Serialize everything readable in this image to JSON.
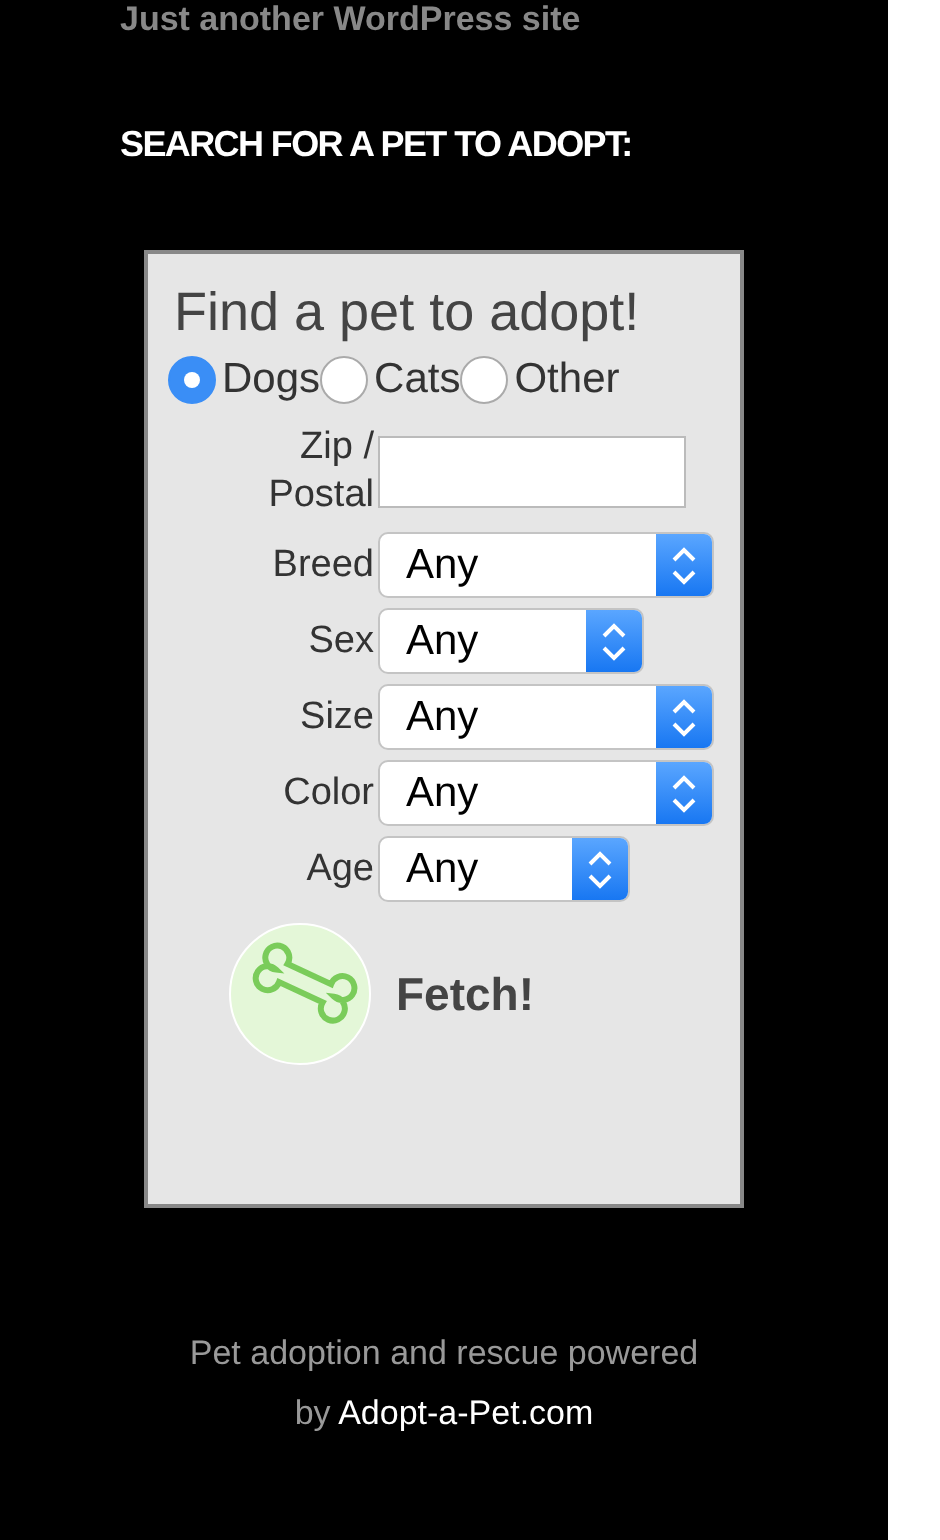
{
  "site_tagline": "Just another WordPress site",
  "widget_title": "SEARCH FOR A PET TO ADOPT:",
  "form": {
    "title": "Find a pet to adopt!",
    "species": [
      {
        "label": "Dogs",
        "selected": true
      },
      {
        "label": "Cats",
        "selected": false
      },
      {
        "label": "Other",
        "selected": false
      }
    ],
    "zip_label": "Zip / Postal",
    "selects": [
      {
        "label": "Breed",
        "value": "Any",
        "kind": "wide"
      },
      {
        "label": "Sex",
        "value": "Any",
        "kind": "narrow"
      },
      {
        "label": "Size",
        "value": "Any",
        "kind": "wide"
      },
      {
        "label": "Color",
        "value": "Any",
        "kind": "wide"
      },
      {
        "label": "Age",
        "value": "Any",
        "kind": "short"
      }
    ],
    "submit": "Fetch!"
  },
  "footer": {
    "text": "Pet adoption and rescue powered by",
    "link": "Adopt-a-Pet.com"
  }
}
